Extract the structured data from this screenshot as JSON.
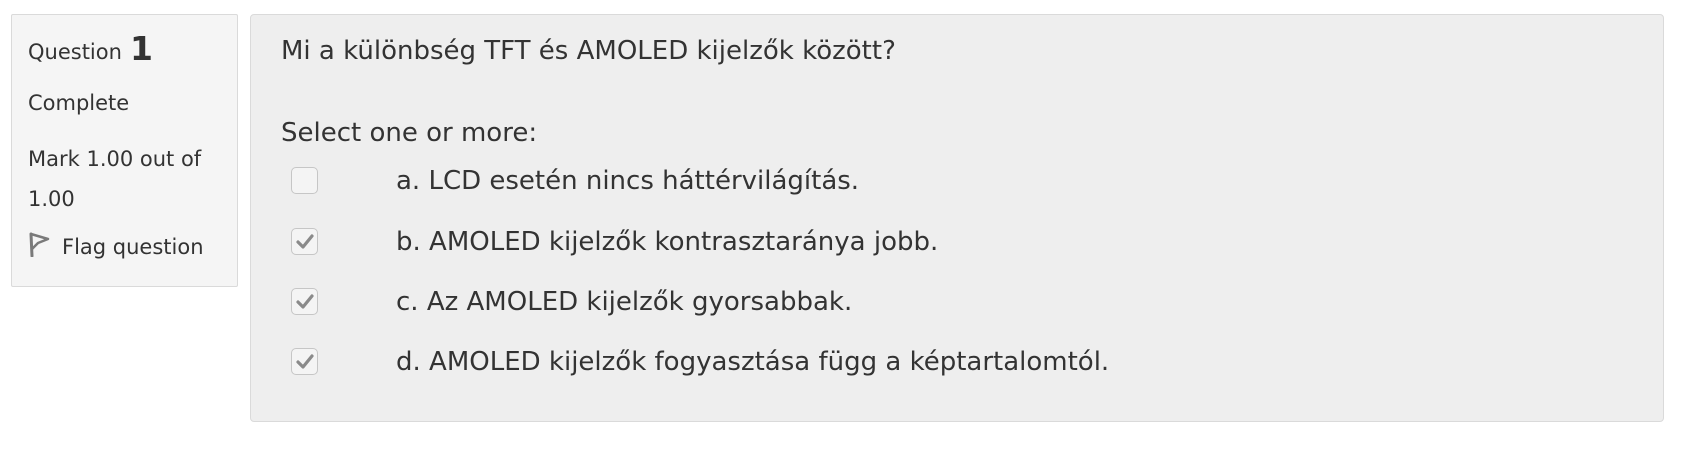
{
  "info": {
    "question_label": "Question",
    "question_number": "1",
    "state": "Complete",
    "grade": "Mark 1.00 out of 1.00",
    "flag_label": "Flag question",
    "flag_icon": "flag-icon"
  },
  "question": {
    "text": "Mi a különbség TFT és AMOLED kijelzők között?",
    "prompt": "Select one or more:",
    "options": [
      {
        "label": "a. LCD esetén nincs háttérvilágítás.",
        "checked": false
      },
      {
        "label": "b. AMOLED kijelzők kontrasztaránya jobb.",
        "checked": true
      },
      {
        "label": "c. Az AMOLED kijelzők gyorsabbak.",
        "checked": true
      },
      {
        "label": "d. AMOLED kijelzők fogyasztása függ a képtartalomtól.",
        "checked": true
      }
    ]
  },
  "colors": {
    "info_bg": "#f5f5f5",
    "content_bg": "#eeeeee",
    "border": "#dadada",
    "text": "#333333",
    "checkmark": "#8a8a8a"
  }
}
